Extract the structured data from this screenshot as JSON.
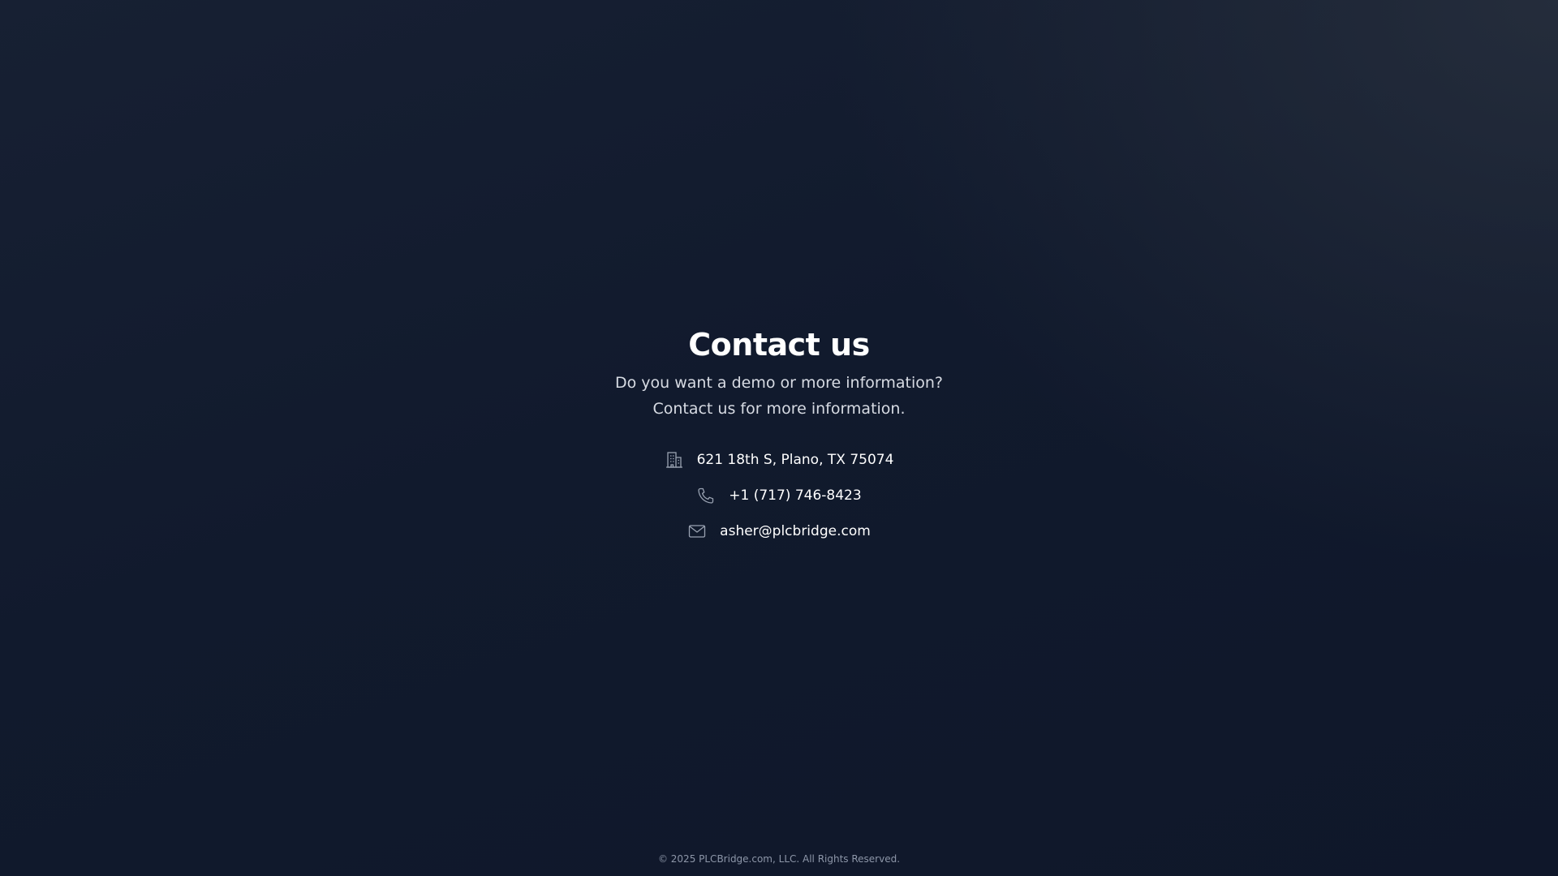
{
  "contact": {
    "title": "Contact us",
    "subtitle_line1": "Do you want a demo or more information?",
    "subtitle_line2": "Contact us for more information.",
    "items": [
      {
        "icon": "building-icon",
        "text": "621 18th S, Plano, TX 75074"
      },
      {
        "icon": "phone-icon",
        "text": "+1 (717) 746-8423"
      },
      {
        "icon": "mail-icon",
        "text": "asher@plcbridge.com"
      }
    ]
  },
  "footer": {
    "copyright": "© 2025 PLCBridge.com, LLC. All Rights Reserved."
  },
  "colors": {
    "background": "#111a2d",
    "title": "#ffffff",
    "subtitle": "#d7dbe3",
    "icon": "#9aa3b2",
    "footer_text": "#8d96a8"
  }
}
